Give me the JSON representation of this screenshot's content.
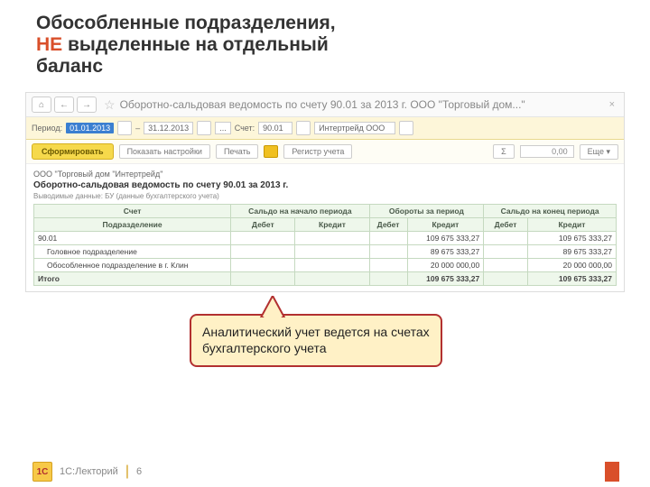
{
  "slide": {
    "title_part1": "Обособленные подразделения,",
    "title_highlight": "НЕ",
    "title_part2": " выделенные на отдельный",
    "title_part3": "баланс"
  },
  "topbar": {
    "home_icon": "⌂",
    "back_icon": "←",
    "fwd_icon": "→",
    "star": "☆",
    "breadcrumb": "Оборотно-сальдовая ведомость по счету 90.01 за 2013 г. ООО \"Торговый дом...\"",
    "close": "×"
  },
  "filter": {
    "period_label": "Период:",
    "date_from": "01.01.2013",
    "sep": "–",
    "date_to": "31.12.2013",
    "dots": "...",
    "account_label": "Счет:",
    "account_value": "90.01",
    "org_value": "Интертрейд ООО"
  },
  "toolbar": {
    "form_btn": "Сформировать",
    "show_settings": "Показать настройки",
    "print": "Печать",
    "register": "Регистр учета",
    "sigma": "Σ",
    "sum": "0,00",
    "more": "Еще ▾"
  },
  "report": {
    "company": "ООО \"Торговый дом \"Интертрейд\"",
    "title": "Оборотно-сальдовая ведомость по счету 90.01 за 2013 г.",
    "subline": "Выводимые данные: БУ (данные бухгалтерского учета)",
    "headers": {
      "account": "Счет",
      "saldo_begin": "Сальдо на начало периода",
      "turnover": "Обороты за период",
      "saldo_end": "Сальдо на конец периода",
      "division": "Подразделение",
      "debit": "Дебет",
      "credit": "Кредит"
    },
    "rows": [
      {
        "label": "90.01",
        "tc": "109 675 333,27",
        "ec": "109 675 333,27"
      },
      {
        "label": "Головное подразделение",
        "tc": "89 675 333,27",
        "ec": "89 675 333,27",
        "indent": true
      },
      {
        "label": "Обособленное подразделение в г. Клин",
        "tc": "20 000 000,00",
        "ec": "20 000 000,00",
        "indent": true
      }
    ],
    "total_label": "Итого",
    "total_tc": "109 675 333,27",
    "total_ec": "109 675 333,27"
  },
  "callout": {
    "text": "Аналитический учет ведется на счетах бухгалтерского учета"
  },
  "footer": {
    "logo_text": "1С",
    "label": "1С:Лекторий",
    "page": "6"
  }
}
